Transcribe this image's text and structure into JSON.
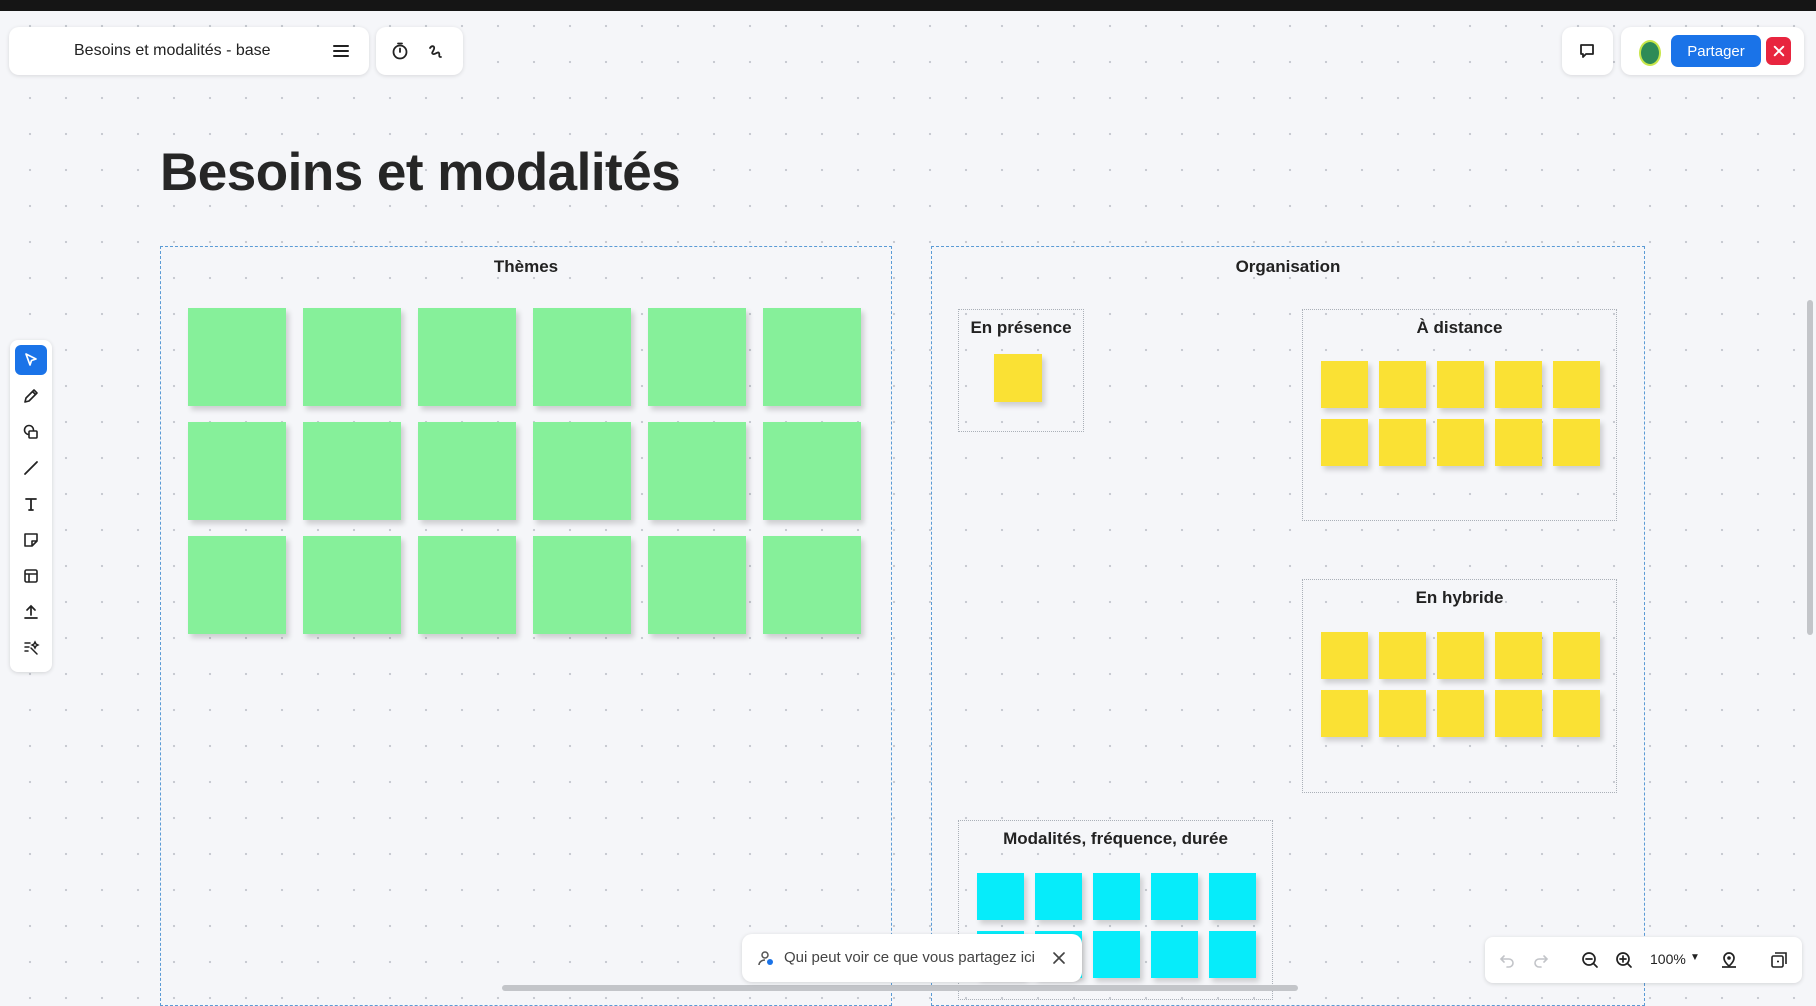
{
  "header": {
    "board_title": "Besoins et modalités - base",
    "share_label": "Partager"
  },
  "canvas": {
    "title": "Besoins et modalités",
    "frames": {
      "themes": {
        "label": "Thèmes",
        "sticky_count": 18,
        "sticky_color": "#86f09a"
      },
      "organisation": {
        "label": "Organisation",
        "en_presence": {
          "label": "En présence",
          "sticky_count": 1
        },
        "a_distance": {
          "label": "À distance",
          "sticky_count": 10
        },
        "en_hybride": {
          "label": "En hybride",
          "sticky_count": 10
        },
        "modalites": {
          "label": "Modalités, fréquence, durée",
          "sticky_count": 10
        }
      }
    }
  },
  "toolbar": {
    "tools": [
      "select-tool",
      "pen-tool",
      "shapes-tool",
      "line-tool",
      "text-tool",
      "sticky-note-tool",
      "template-tool",
      "upload-tool",
      "ai-tool"
    ],
    "active": "select-tool"
  },
  "toast": {
    "text": "Qui peut voir ce que vous partagez ici"
  },
  "zoom": {
    "level": "100%"
  },
  "colors": {
    "accent": "#1a73e8",
    "close": "#e8253f",
    "green_note": "#86f09a",
    "yellow_note": "#fae134",
    "cyan_note": "#06ecfa",
    "frame_border": "#5b9bd5"
  }
}
